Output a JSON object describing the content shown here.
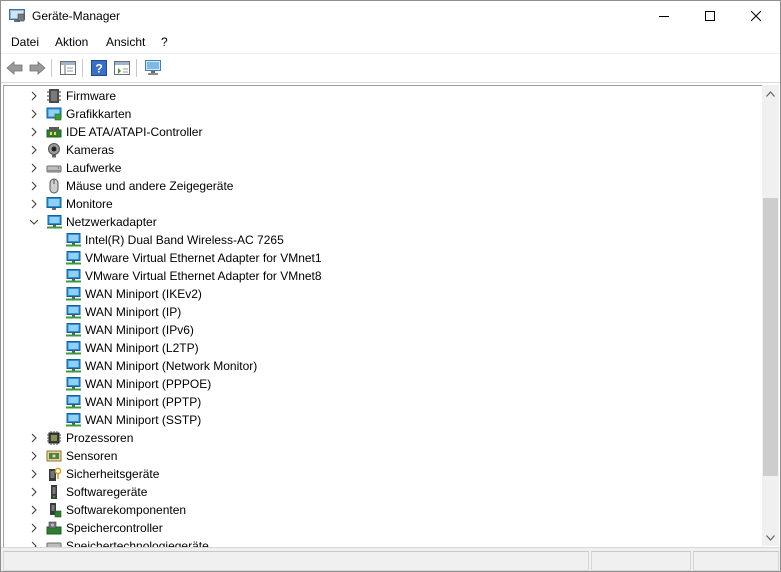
{
  "window": {
    "title": "Geräte-Manager"
  },
  "menu": [
    "Datei",
    "Aktion",
    "Ansicht",
    "?"
  ],
  "toolbar": {
    "icons": [
      "back-arrow-icon",
      "forward-arrow-icon",
      "properties-view-icon",
      "help-icon",
      "update-driver-icon",
      "monitor-scan-icon"
    ]
  },
  "tree": {
    "items": [
      {
        "label": "Firmware",
        "icon": "firmware-icon",
        "level": 0,
        "expanded": false
      },
      {
        "label": "Grafikkarten",
        "icon": "display-adapter-icon",
        "level": 0,
        "expanded": false
      },
      {
        "label": "IDE ATA/ATAPI-Controller",
        "icon": "ide-controller-icon",
        "level": 0,
        "expanded": false
      },
      {
        "label": "Kameras",
        "icon": "camera-icon",
        "level": 0,
        "expanded": false
      },
      {
        "label": "Laufwerke",
        "icon": "drive-icon",
        "level": 0,
        "expanded": false
      },
      {
        "label": "Mäuse und andere Zeigegeräte",
        "icon": "mouse-icon",
        "level": 0,
        "expanded": false
      },
      {
        "label": "Monitore",
        "icon": "monitor-icon",
        "level": 0,
        "expanded": false
      },
      {
        "label": "Netzwerkadapter",
        "icon": "network-adapter-icon",
        "level": 0,
        "expanded": true
      },
      {
        "label": "Intel(R) Dual Band Wireless-AC 7265",
        "icon": "network-adapter-icon",
        "level": 1
      },
      {
        "label": "VMware Virtual Ethernet Adapter for VMnet1",
        "icon": "network-adapter-icon",
        "level": 1
      },
      {
        "label": "VMware Virtual Ethernet Adapter for VMnet8",
        "icon": "network-adapter-icon",
        "level": 1
      },
      {
        "label": "WAN Miniport (IKEv2)",
        "icon": "network-adapter-icon",
        "level": 1
      },
      {
        "label": "WAN Miniport (IP)",
        "icon": "network-adapter-icon",
        "level": 1
      },
      {
        "label": "WAN Miniport (IPv6)",
        "icon": "network-adapter-icon",
        "level": 1
      },
      {
        "label": "WAN Miniport (L2TP)",
        "icon": "network-adapter-icon",
        "level": 1
      },
      {
        "label": "WAN Miniport (Network Monitor)",
        "icon": "network-adapter-icon",
        "level": 1
      },
      {
        "label": "WAN Miniport (PPPOE)",
        "icon": "network-adapter-icon",
        "level": 1
      },
      {
        "label": "WAN Miniport (PPTP)",
        "icon": "network-adapter-icon",
        "level": 1
      },
      {
        "label": "WAN Miniport (SSTP)",
        "icon": "network-adapter-icon",
        "level": 1
      },
      {
        "label": "Prozessoren",
        "icon": "processor-icon",
        "level": 0,
        "expanded": false
      },
      {
        "label": "Sensoren",
        "icon": "sensor-icon",
        "level": 0,
        "expanded": false
      },
      {
        "label": "Sicherheitsgeräte",
        "icon": "security-device-icon",
        "level": 0,
        "expanded": false
      },
      {
        "label": "Softwaregeräte",
        "icon": "software-device-icon",
        "level": 0,
        "expanded": false
      },
      {
        "label": "Softwarekomponenten",
        "icon": "software-component-icon",
        "level": 0,
        "expanded": false
      },
      {
        "label": "Speichercontroller",
        "icon": "storage-controller-icon",
        "level": 0,
        "expanded": false
      },
      {
        "label": "Speichertechnologiegeräte",
        "icon": "storage-technology-icon",
        "level": 0,
        "expanded": false
      }
    ]
  },
  "colors": {
    "accent": "#1e90d8",
    "selection": "#cce8ff"
  }
}
